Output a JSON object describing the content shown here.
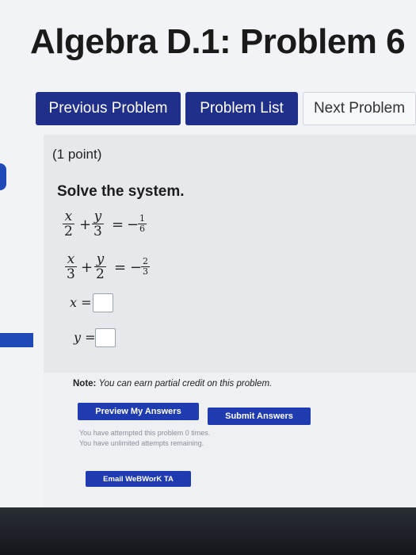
{
  "page": {
    "title": "Algebra D.1: Problem 6"
  },
  "nav": {
    "previous": "Previous Problem",
    "list": "Problem List",
    "next": "Next Problem"
  },
  "problem": {
    "points": "(1 point)",
    "instruction": "Solve the system.",
    "eq1": {
      "t1n": "x",
      "t1d": "2",
      "op": "+",
      "t2n": "y",
      "t2d": "3",
      "eq": "=",
      "neg": "−",
      "rn": "1",
      "rd": "6"
    },
    "eq2": {
      "t1n": "x",
      "t1d": "3",
      "op": "+",
      "t2n": "y",
      "t2d": "2",
      "eq": "=",
      "neg": "−",
      "rn": "2",
      "rd": "3"
    },
    "x_label": "x =",
    "y_label": "y =",
    "x_value": "",
    "y_value": ""
  },
  "note": {
    "label": "Note:",
    "text": "You can earn partial credit on this problem."
  },
  "buttons": {
    "preview": "Preview My Answers",
    "submit": "Submit Answers",
    "email": "Email WeBWorK TA"
  },
  "attempts": {
    "line1": "You have attempted this problem 0 times.",
    "line2": "You have unlimited attempts remaining."
  },
  "colors": {
    "primary": "#1f2f8a",
    "button": "#1f3bb0",
    "panel": "#e6e8ec"
  }
}
